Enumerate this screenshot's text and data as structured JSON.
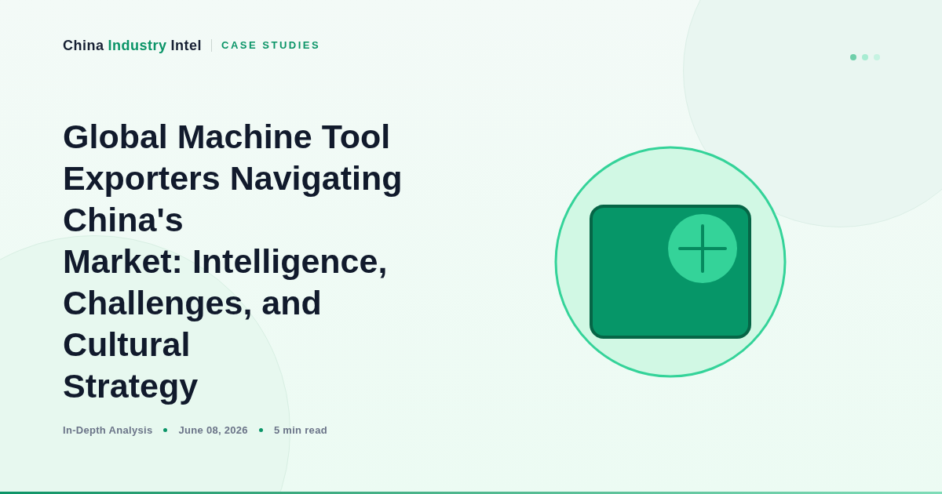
{
  "brand": {
    "parts": [
      {
        "text": "China",
        "highlight": false
      },
      {
        "text": "Industry",
        "highlight": true
      },
      {
        "text": "Intel",
        "highlight": false
      }
    ]
  },
  "category": "CASE STUDIES",
  "dots": [
    {
      "color": "#6fcfaa"
    },
    {
      "color": "#a7ecd2"
    },
    {
      "color": "#c6f3e2"
    }
  ],
  "title_lines": [
    "Global Machine Tool",
    "Exporters Navigating",
    "China's",
    "Market: Intelligence,",
    "Challenges, and",
    "Cultural",
    "Strategy"
  ],
  "meta": [
    "In-Depth Analysis",
    "June 08, 2026",
    "5 min read"
  ]
}
